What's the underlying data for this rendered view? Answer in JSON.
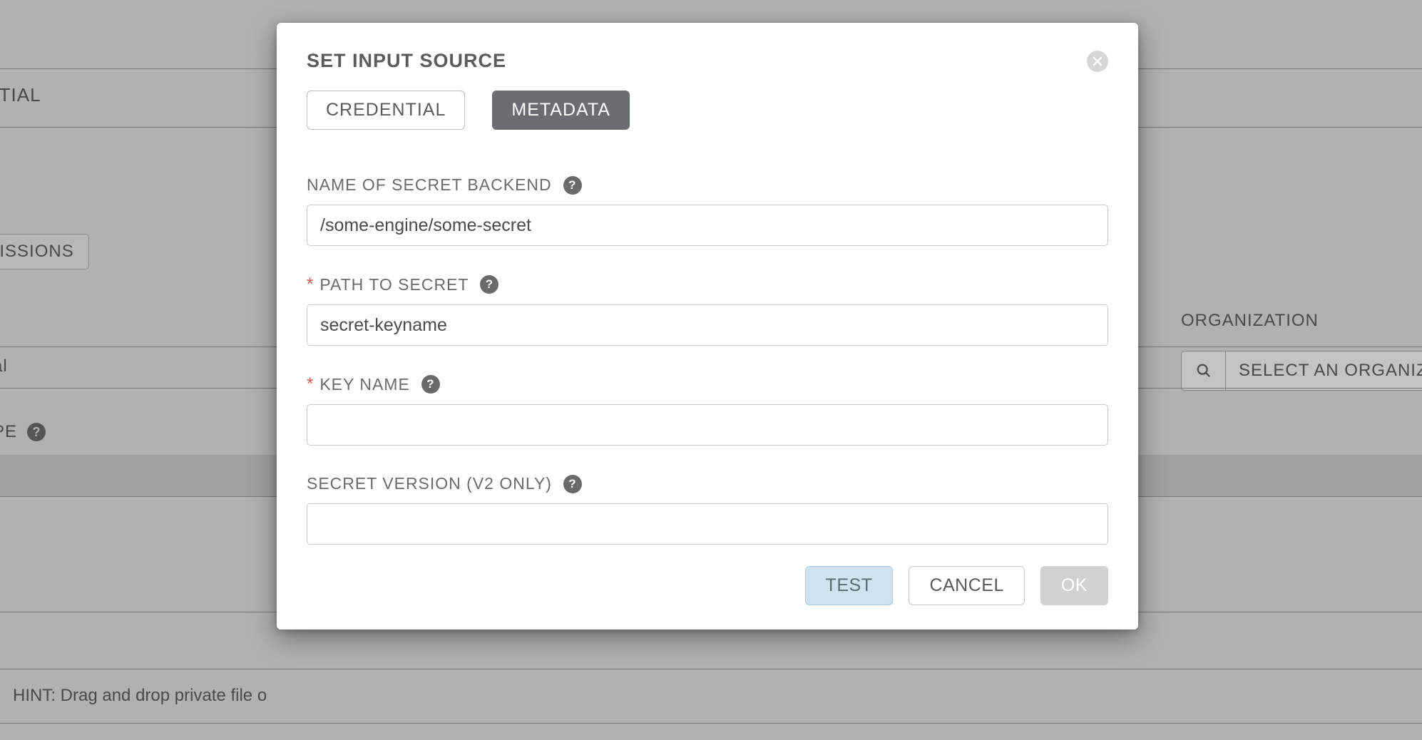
{
  "background": {
    "header_title_fragment": "IT CREDENTIAL",
    "sidebar_item_fragment": "l",
    "permissions_button": "PERMISSIONS",
    "something_al": "al",
    "type_label_fragment": "PE",
    "hint_text": "HINT: Drag and drop private file o",
    "org_label": "ORGANIZATION",
    "org_select_placeholder": "SELECT AN ORGANIZ"
  },
  "modal": {
    "title": "SET INPUT SOURCE",
    "tabs": {
      "credential": "CREDENTIAL",
      "metadata": "METADATA"
    },
    "fields": {
      "backend": {
        "label": "NAME OF SECRET BACKEND",
        "value": "/some-engine/some-secret",
        "required": false
      },
      "path": {
        "label": "PATH TO SECRET",
        "value": "secret-keyname",
        "required": true
      },
      "keyname": {
        "label": "KEY NAME",
        "value": "",
        "required": true
      },
      "version": {
        "label": "SECRET VERSION (V2 ONLY)",
        "value": "",
        "required": false
      }
    },
    "buttons": {
      "test": "TEST",
      "cancel": "CANCEL",
      "ok": "OK"
    }
  }
}
